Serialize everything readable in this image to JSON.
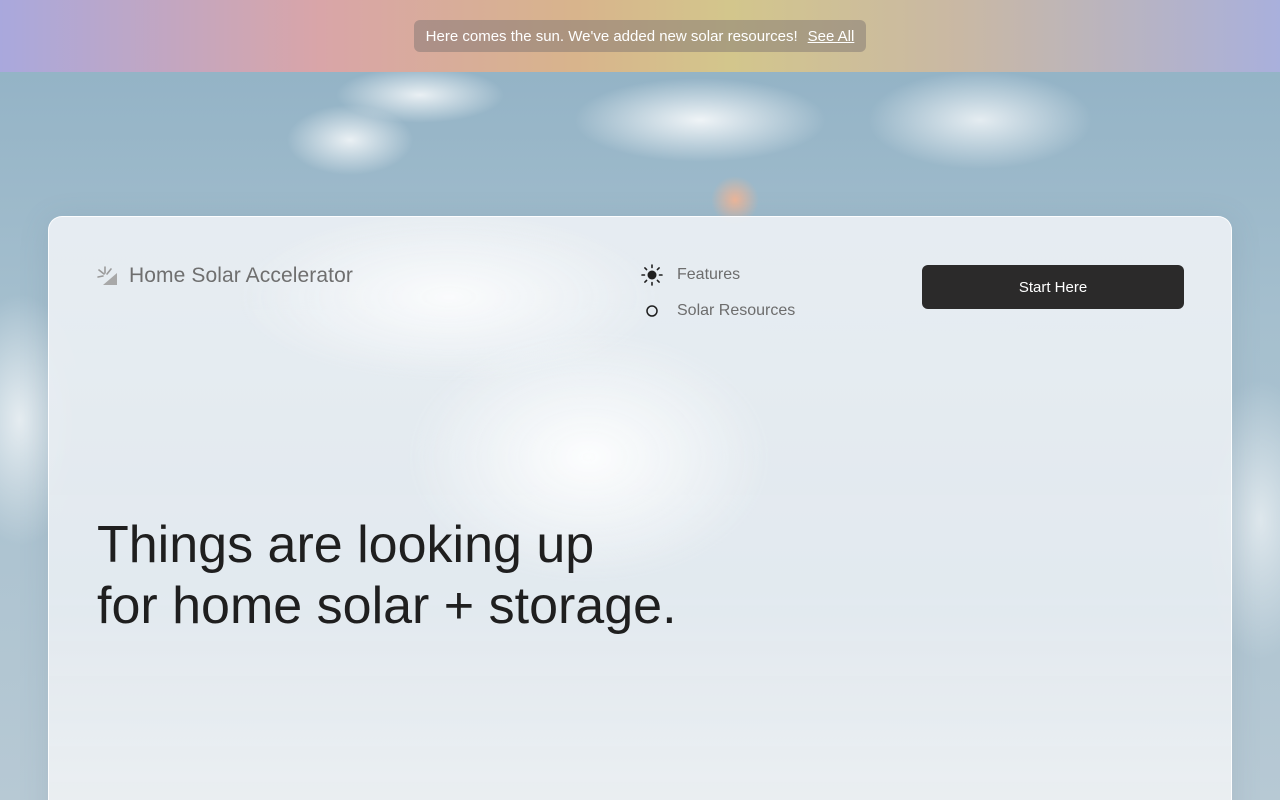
{
  "banner": {
    "message": "Here comes the sun. We've added new solar resources!",
    "link_label": "See All"
  },
  "brand": {
    "name": "Home Solar Accelerator",
    "icon": "solar-spark-icon"
  },
  "nav": {
    "items": [
      {
        "label": "Features",
        "icon": "sun-icon",
        "active": true
      },
      {
        "label": "Solar Resources",
        "icon": "circle-outline-icon",
        "active": false
      }
    ]
  },
  "cta": {
    "label": "Start Here"
  },
  "hero": {
    "line1": "Things are looking up",
    "line2": "for home solar + storage."
  },
  "colors": {
    "cta_background": "#2b2a2a",
    "hero_text": "#1f1f1f",
    "nav_text": "#6d6d6d"
  }
}
